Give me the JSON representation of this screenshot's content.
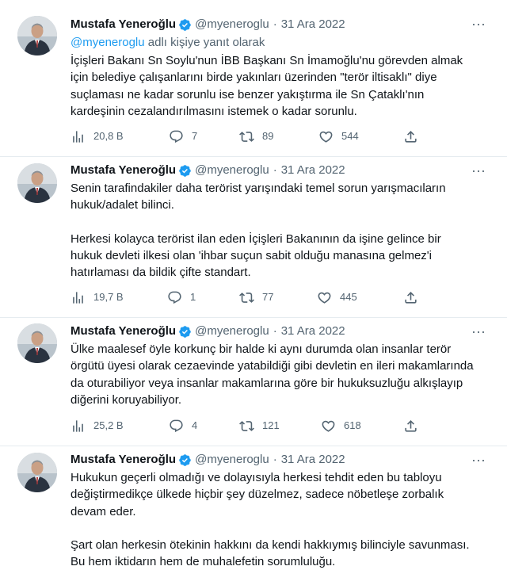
{
  "tweets": [
    {
      "name": "Mustafa Yeneroğlu",
      "handle": "@myeneroglu",
      "date": "31 Ara 2022",
      "reply_mention": "@myeneroglu",
      "reply_suffix": " adlı kişiye yanıt olarak",
      "text": "İçişleri Bakanı Sn Soylu'nun İBB Başkanı Sn İmamoğlu'nu görevden almak\niçin belediye çalışanlarını birde yakınları üzerinden \"terör iltisaklı\" diye\nsuçlaması ne kadar sorunlu ise benzer yakıştırma ile Sn Çataklı'nın\nkardeşinin cezalandırılmasını istemek o kadar sorunlu.",
      "views": "20,8 B",
      "replies": "7",
      "retweets": "89",
      "likes": "544"
    },
    {
      "name": "Mustafa Yeneroğlu",
      "handle": "@myeneroglu",
      "date": "31 Ara 2022",
      "text": "Senin tarafindakiler daha terörist yarışındaki temel sorun yarışmacıların\nhukuk/adalet bilinci.\n\nHerkesi kolayca terörist ilan eden İçişleri Bakanının da işine gelince bir\nhukuk devleti ilkesi olan 'ihbar suçun sabit olduğu manasına gelmez'i\nhatırlaması da bildik çifte standart.",
      "views": "19,7 B",
      "replies": "1",
      "retweets": "77",
      "likes": "445"
    },
    {
      "name": "Mustafa Yeneroğlu",
      "handle": "@myeneroglu",
      "date": "31 Ara 2022",
      "text": "Ülke maalesef öyle korkunç bir halde ki aynı durumda olan insanlar terör\nörgütü üyesi olarak cezaevinde yatabildiği gibi devletin en ileri makamlarında\nda oturabiliyor veya insanlar makamlarına göre bir hukuksuzluğu alkışlayıp\ndiğerini koruyabiliyor.",
      "views": "25,2 B",
      "replies": "4",
      "retweets": "121",
      "likes": "618"
    },
    {
      "name": "Mustafa Yeneroğlu",
      "handle": "@myeneroglu",
      "date": "31 Ara 2022",
      "text": "Hukukun geçerli olmadığı ve dolayısıyla herkesi tehdit eden bu tabloyu\ndeğiştirmedikçe ülkede hiçbir şey düzelmez, sadece nöbetleşe zorbalık\ndevam eder.\n\nŞart olan herkesin ötekinin hakkını da kendi hakkıymış bilinciyle savunması.\nBu hem iktidarın hem de muhalefetin sorumluluğu."
    }
  ],
  "icons": {
    "verified": "verified-badge-icon",
    "views": "bar-chart-icon",
    "reply": "speech-bubble-icon",
    "retweet": "retweet-arrows-icon",
    "like": "heart-icon",
    "share": "share-upload-icon",
    "more": "more-dots-icon"
  },
  "colors": {
    "accent": "#1d9bf0",
    "muted": "#536471",
    "text": "#0f1419"
  }
}
